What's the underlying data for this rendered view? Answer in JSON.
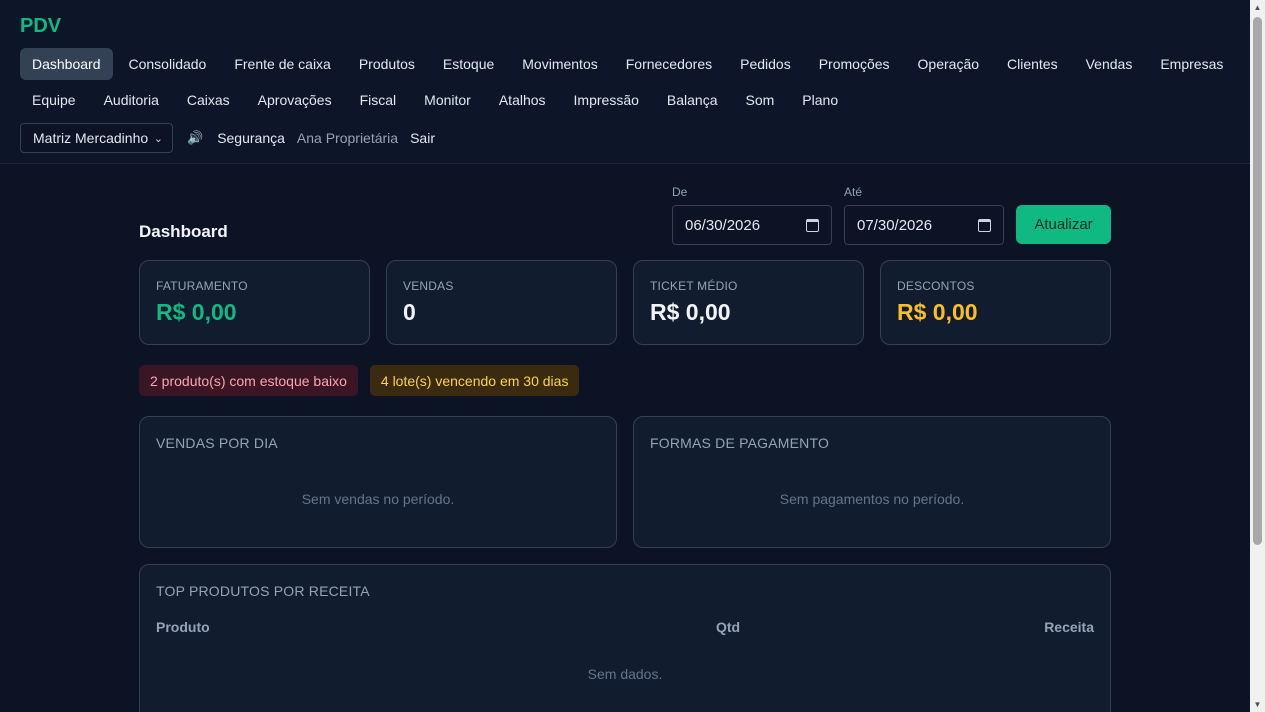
{
  "brand": "PDV",
  "nav_row1": [
    "Dashboard",
    "Consolidado",
    "Frente de caixa",
    "Produtos",
    "Estoque",
    "Movimentos",
    "Fornecedores",
    "Pedidos",
    "Promoções",
    "Operação",
    "Clientes",
    "Vendas",
    "Empresas"
  ],
  "nav_row2": [
    "Equipe",
    "Auditoria",
    "Caixas",
    "Aprovações",
    "Fiscal",
    "Monitor",
    "Atalhos",
    "Impressão",
    "Balança",
    "Som",
    "Plano"
  ],
  "active_nav": "Dashboard",
  "toolbar": {
    "store_select": "Matriz Mercadinho",
    "speaker_glyph": "🔊",
    "security": "Segurança",
    "user": "Ana Proprietária",
    "logout": "Sair"
  },
  "main": {
    "title": "Dashboard",
    "from_label": "De",
    "from_value": "06/30/2026",
    "to_label": "Até",
    "to_value": "07/30/2026",
    "refresh": "Atualizar"
  },
  "kpis": [
    {
      "label": "FATURAMENTO",
      "value": "R$ 0,00",
      "color": "#10b981"
    },
    {
      "label": "VENDAS",
      "value": "0",
      "color": "#f1f5f9"
    },
    {
      "label": "TICKET MÉDIO",
      "value": "R$ 0,00",
      "color": "#f1f5f9"
    },
    {
      "label": "DESCONTOS",
      "value": "R$ 0,00",
      "color": "#fbbf24"
    }
  ],
  "alerts": {
    "low_stock": "2 produto(s) com estoque baixo",
    "expiring": "4 lote(s) vencendo em 30 dias"
  },
  "panels": {
    "sales_by_day": {
      "title": "VENDAS POR DIA",
      "empty": "Sem vendas no período."
    },
    "payment_methods": {
      "title": "FORMAS DE PAGAMENTO",
      "empty": "Sem pagamentos no período."
    }
  },
  "top_products": {
    "title": "TOP PRODUTOS POR RECEITA",
    "columns": [
      "Produto",
      "Qtd",
      "Receita"
    ],
    "empty": "Sem dados."
  }
}
